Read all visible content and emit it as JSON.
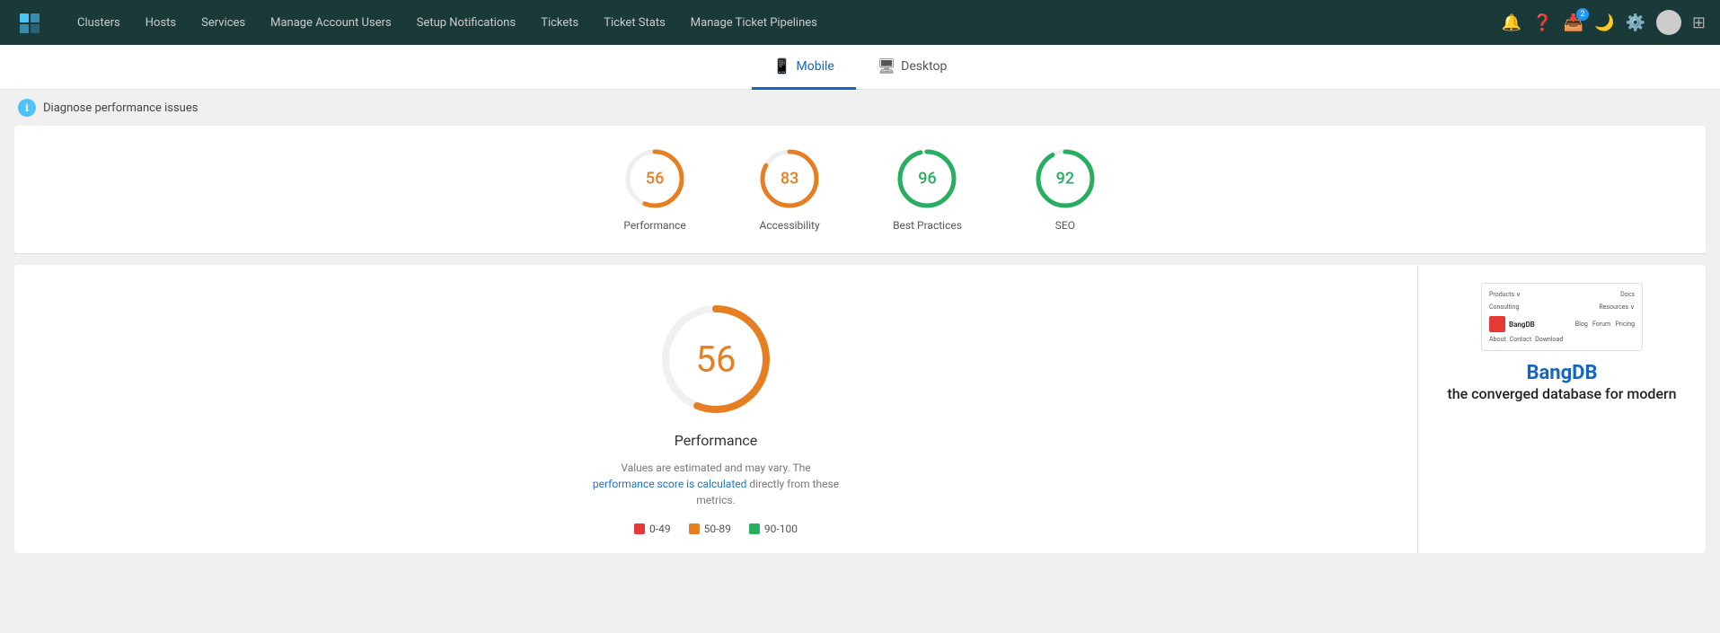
{
  "navbar": {
    "logo_alt": "Logo",
    "items": [
      {
        "label": "Clusters",
        "id": "clusters"
      },
      {
        "label": "Hosts",
        "id": "hosts"
      },
      {
        "label": "Services",
        "id": "services"
      },
      {
        "label": "Manage Account Users",
        "id": "manage-account-users"
      },
      {
        "label": "Setup Notifications",
        "id": "setup-notifications"
      },
      {
        "label": "Tickets",
        "id": "tickets"
      },
      {
        "label": "Ticket Stats",
        "id": "ticket-stats"
      },
      {
        "label": "Manage Ticket Pipelines",
        "id": "manage-ticket-pipelines"
      }
    ],
    "notification_badge": "2"
  },
  "tabs": [
    {
      "label": "Mobile",
      "icon": "📱",
      "active": true
    },
    {
      "label": "Desktop",
      "icon": "🖥",
      "active": false
    }
  ],
  "diagnose": {
    "text": "Diagnose performance issues"
  },
  "scores": [
    {
      "value": 56,
      "label": "Performance",
      "color": "#e67e22",
      "pct": 56
    },
    {
      "value": 83,
      "label": "Accessibility",
      "color": "#e67e22",
      "pct": 83
    },
    {
      "value": 96,
      "label": "Best Practices",
      "color": "#27ae60",
      "pct": 96
    },
    {
      "value": 92,
      "label": "SEO",
      "color": "#27ae60",
      "pct": 92
    }
  ],
  "big_score": {
    "value": 56,
    "label": "Performance",
    "color": "#e67e22",
    "description_prefix": "Values are estimated and may vary. The ",
    "description_link": "performance score is calculated",
    "description_suffix": " directly from these metrics.",
    "legend": [
      {
        "color": "#e53935",
        "range": "0-49"
      },
      {
        "color": "#e67e22",
        "range": "50-89"
      },
      {
        "color": "#27ae60",
        "range": "90-100"
      }
    ]
  },
  "website_preview": {
    "menu_items": [
      "Products ∨",
      "Docs",
      "Consulting",
      "Resources ∨",
      "Forum",
      "Pricing",
      "About",
      "Contact",
      "Download"
    ],
    "logo_label": "BangDB"
  },
  "bangdb_promo": {
    "logo": "BangDB",
    "tagline": "the converged database for modern"
  }
}
